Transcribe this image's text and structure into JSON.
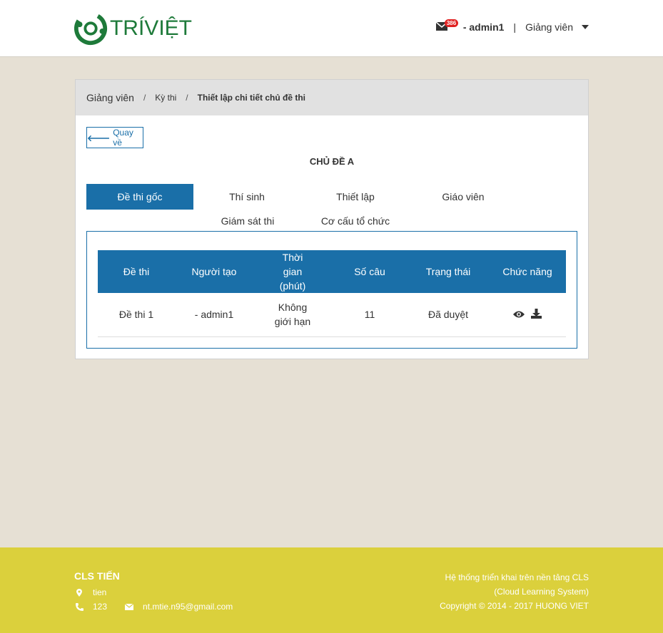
{
  "header": {
    "logo_text": "TRÍVIỆT",
    "mail_badge": "386",
    "user": "- admin1",
    "separator": "|",
    "role": "Giảng viên"
  },
  "breadcrumb": {
    "items": [
      "Giảng viên",
      "Kỳ thi",
      "Thiết lập chi tiết chủ đề thi"
    ],
    "separator": "/"
  },
  "back_button": "Quay về",
  "page_title": "CHỦ ĐỀ A",
  "tabs": [
    {
      "label": "Đề thi gốc",
      "active": true
    },
    {
      "label": "Thí sinh",
      "active": false
    },
    {
      "label": "Thiết lập",
      "active": false
    },
    {
      "label": "Giáo viên",
      "active": false
    },
    {
      "label": "Giám sát thi",
      "active": false
    },
    {
      "label": "Cơ cấu tổ chức",
      "active": false
    }
  ],
  "table": {
    "headers": [
      "Đề thi",
      "Người tạo",
      "Thời gian (phút)",
      "Số câu",
      "Trạng thái",
      "Chức năng"
    ],
    "rows": [
      {
        "name": "Đề thi 1",
        "creator": "- admin1",
        "time": "Không giới hạn",
        "questions": "11",
        "status": "Đã duyệt"
      }
    ]
  },
  "footer": {
    "title": "CLS TIẾN",
    "location": "tien",
    "phone": "123",
    "email": "nt.mtie.n95@gmail.com",
    "right_line1": "Hệ thống triển khai trên nền tảng CLS",
    "right_line2": "(Cloud Learning System)",
    "right_line3": "Copyright © 2014 - 2017 HUONG VIET"
  },
  "colors": {
    "primary": "#1a6fa8",
    "background": "#e6e0d4",
    "footer": "#dbd03c",
    "logo": "#1e7a3a",
    "badge": "#e02020"
  }
}
